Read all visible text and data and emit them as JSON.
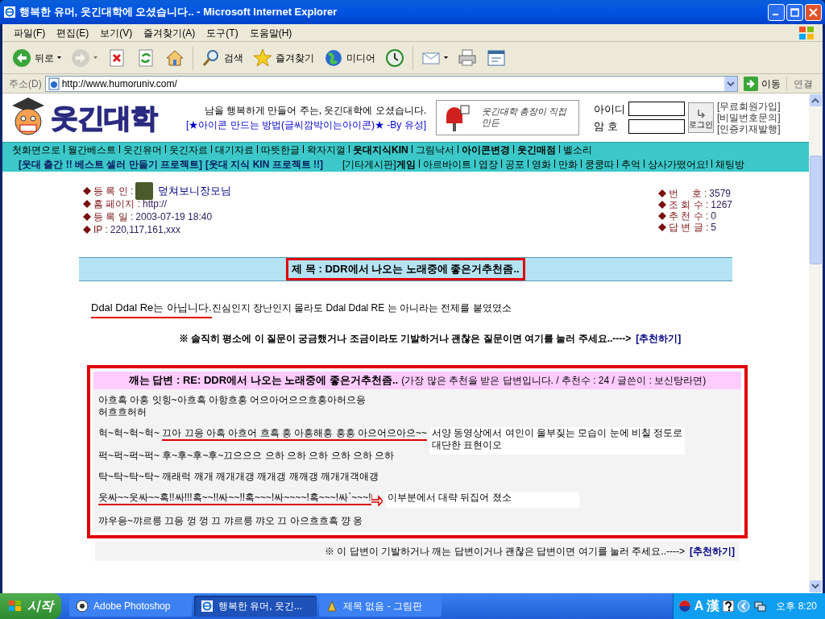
{
  "window": {
    "title": "행복한 유머, 웃긴대학에 오셨습니다.. - Microsoft Internet Explorer"
  },
  "menu": [
    "파일(F)",
    "편집(E)",
    "보기(V)",
    "즐겨찾기(A)",
    "도구(T)",
    "도움말(H)"
  ],
  "toolbar": [
    {
      "kind": "back",
      "label": "뒤로",
      "dropdown": true,
      "disabled": false
    },
    {
      "kind": "forward",
      "dropdown": true,
      "disabled": true
    },
    {
      "kind": "stop",
      "dropdown": false,
      "disabled": false
    },
    {
      "kind": "refresh",
      "dropdown": false,
      "disabled": false
    },
    {
      "kind": "home",
      "dropdown": false,
      "disabled": false
    },
    {
      "kind": "search",
      "label": "검색",
      "dropdown": false,
      "disabled": false
    },
    {
      "kind": "favorites",
      "label": "즐겨찾기",
      "dropdown": false,
      "disabled": false
    },
    {
      "kind": "media",
      "label": "미디어",
      "dropdown": false,
      "disabled": false
    },
    {
      "kind": "history",
      "dropdown": false,
      "disabled": false
    },
    {
      "kind": "mail",
      "dropdown": true,
      "disabled": false
    },
    {
      "kind": "print",
      "dropdown": false,
      "disabled": false
    },
    {
      "kind": "edit",
      "dropdown": false,
      "disabled": false
    }
  ],
  "address_bar": {
    "label": "주소(D)",
    "url": "http://www.humoruniv.com/",
    "go": "이동",
    "links": "연결"
  },
  "site_header": {
    "logo": "웃긴대학",
    "welcome": "남을 행복하게 만들어 주는, 웃긴대학에 오셨습니다.",
    "icon_link": "[★아이콘 만드는 방법(글씨깜박이는아이콘)★ -By 유성]",
    "banner": "웃긴대학 총장이 직접 만든",
    "login": {
      "id_label": "아이디",
      "pw_label": "암 호",
      "button": "로그인"
    },
    "links": [
      "[무료회원가입]",
      "[비밀번호문의]",
      "[인증키재발행]"
    ]
  },
  "nav_primary": [
    {
      "label": "첫화면으로",
      "bold": false
    },
    {
      "label": "월간베스트",
      "bold": false
    },
    {
      "label": "웃긴유머",
      "bold": false
    },
    {
      "label": "웃긴자료",
      "bold": false
    },
    {
      "label": "대기자료",
      "bold": false
    },
    {
      "label": "따뜻한글",
      "bold": false
    },
    {
      "label": "왁자지껄",
      "bold": false
    },
    {
      "label": "웃대지식KIN",
      "bold": true
    },
    {
      "label": "그림낙서",
      "bold": false
    },
    {
      "label": "아이콘변경",
      "bold": true
    },
    {
      "label": "웃긴매점",
      "bold": true
    },
    {
      "label": "벨소리",
      "bold": false
    }
  ],
  "nav_secondary": {
    "projects": [
      "[웃대 출간 !! 베스트 셀러 만들기 프로젝트]",
      "[웃대 지식 KIN 프로젝트 !!]"
    ],
    "items": [
      {
        "label": "[기타게시판]",
        "bold": false
      },
      {
        "label": "게임",
        "bold": true
      },
      {
        "label": "아르바이트",
        "bold": false
      },
      {
        "label": "엽장",
        "bold": false
      },
      {
        "label": "공포",
        "bold": false
      },
      {
        "label": "영화",
        "bold": false
      },
      {
        "label": "만화",
        "bold": false
      },
      {
        "label": "쿵쿵따",
        "bold": false
      },
      {
        "label": "추억",
        "bold": false
      },
      {
        "label": "상사가떴어요!",
        "bold": false
      },
      {
        "label": "채팅방",
        "bold": false
      }
    ]
  },
  "post_meta": {
    "left": [
      {
        "label": "등 록 인 :",
        "value": "덮쳐보니장모님",
        "avatar": true
      },
      {
        "label": "홈 페이지 :",
        "value": "http://",
        "avatar": false
      },
      {
        "label": "등 록 일 :",
        "value": "2003-07-19 18:40",
        "avatar": false
      },
      {
        "label": "IP :",
        "value": "220,117,161,xxx",
        "avatar": false
      }
    ],
    "right": [
      {
        "label": "번     호 :",
        "value": "3579"
      },
      {
        "label": "조 회 수 :",
        "value": "1267"
      },
      {
        "label": "추 천 수 :",
        "value": "0"
      },
      {
        "label": "답 변 글 :",
        "value": "5"
      }
    ]
  },
  "subject": {
    "text": "제 목 : DDR에서 나오는 노래중에 좋은거추천좀..",
    "highlighted": true
  },
  "body": [
    {
      "text": "Ddal Ddal Re는 아닙니다.",
      "underlined": true
    },
    {
      "text": "진심인지 장난인지 몰라도 Ddal Ddal RE 는 아니라는 전제를 붙였였소",
      "underlined": false
    }
  ],
  "recommend": {
    "text": "※ 솔직히 평소에 이 질문이 궁금했거나 조금이라도 기발하거나 괜찮은 질문이면 여기를 눌러 주세요..---->",
    "link": "[추천하기]"
  },
  "best_answer": {
    "highlighted": true,
    "title": "깨는 답변 : RE: DDR에서 나오는 노래중에 좋은거추천좀..",
    "info": "(가장 많은 추천을 받은 답변입니다. / 추천수 : 24 / 글쓴이 : 보신탕라면)",
    "paragraphs": [
      {
        "lines": [
          [
            {
              "text": "아흐흑 아흥 잇힝~아흐흑 아항흐흥 어으아어으으흐흥아허으응",
              "underlined": false
            }
          ],
          [
            {
              "text": "허흐흐허허",
              "underlined": false
            }
          ]
        ]
      },
      {
        "lines": [
          [
            {
              "text": "헉~헉~헉~헉~ ",
              "underlined": false
            },
            {
              "text": "끄아 끄응 아흑 아흐어 흐흑 흥 아흥해흥 흥흥 아으어으아으~~",
              "underlined": true
            }
          ]
        ],
        "note": "서양 동영상에서 여인이 울부짖는 모습이 눈에 비칠 정도로  대단한 표현이오",
        "arrow": false
      },
      {
        "lines": [
          [
            {
              "text": "퍽~퍽~퍽~퍽~ 후~후~후~후~끄으으으 으하 으하 으하 으하 으하 으하",
              "underlined": false
            }
          ]
        ]
      },
      {
        "lines": [
          [
            {
              "text": "탁~탁~탁~탁~ 깨래럭 깨개 깨개개갱 깨개갱 깨깨갱 깨개개객애갱",
              "underlined": false
            }
          ]
        ]
      },
      {
        "lines": [
          [
            {
              "text": "웃싸~~웃싸~~혹!!싸!!!혹~~!!싸~~!!혹~~~!싸~~~~!혹~~~!싸`~~~!",
              "underlined": true
            }
          ]
        ],
        "note": "이부분에서 대략 뒤집어 졌소",
        "arrow": true
      },
      {
        "lines": [
          [
            {
              "text": "꺄우응~꺄르릉 끄응 껑 껑 끄 꺄르릉 꺄오 끄 아으흐흐흑 꺙 옹",
              "underlined": false
            }
          ]
        ]
      }
    ],
    "recommend": {
      "text": "※ 이 답변이 기발하거나 깨는 답변이거나 괜찮은 답변이면 여기를 눌러 주세요..---->",
      "link": "[추천하기]"
    }
  },
  "taskbar": {
    "start": "시작",
    "tasks": [
      {
        "label": "Adobe Photoshop",
        "kind": "photoshop",
        "selected": false
      },
      {
        "label": "행복한 유머, 웃긴...",
        "kind": "browser",
        "selected": true
      },
      {
        "label": "제목 없음 - 그림판",
        "kind": "paint",
        "selected": false
      }
    ],
    "tray": {
      "ime_mode": "A",
      "hanja": "漢"
    },
    "clock": "오후 8:20"
  }
}
